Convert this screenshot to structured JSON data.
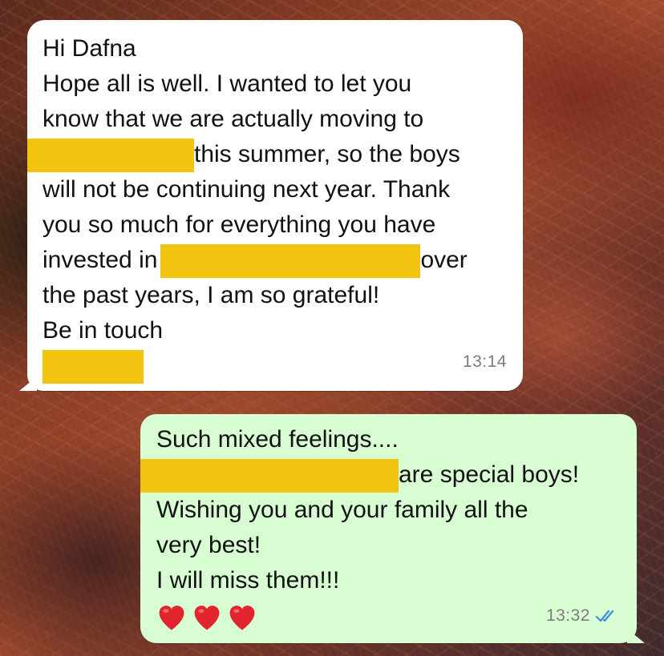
{
  "incoming": {
    "lines": {
      "l1": "Hi Dafna",
      "l2": "Hope all is well.  I wanted to let you",
      "l3": "know that we are actually moving to",
      "l4_after": "this summer, so the boys",
      "l5": "will not be continuing next year. Thank",
      "l6": "you so much for everything you have",
      "l7_before": "invested in",
      "l7_after": "over",
      "l8": "the past years, I am so grateful!",
      "l9": "Be in touch"
    },
    "time": "13:14"
  },
  "outgoing": {
    "lines": {
      "l1": "Such mixed feelings....",
      "l2_after": "are special boys!",
      "l3": "Wishing you and your family all the",
      "l4": "very best!",
      "l5": "I will miss them!!!"
    },
    "hearts": [
      "heart-icon",
      "heart-icon",
      "heart-icon"
    ],
    "time": "13:32",
    "status_icon": "double-check-icon",
    "colors": {
      "bubble": "#d9fdd3",
      "read_ticks": "#3a8fd8"
    }
  },
  "colors": {
    "redaction": "#f1c40f",
    "incoming_bubble": "#ffffff",
    "timestamp": "#7b7b7b"
  }
}
